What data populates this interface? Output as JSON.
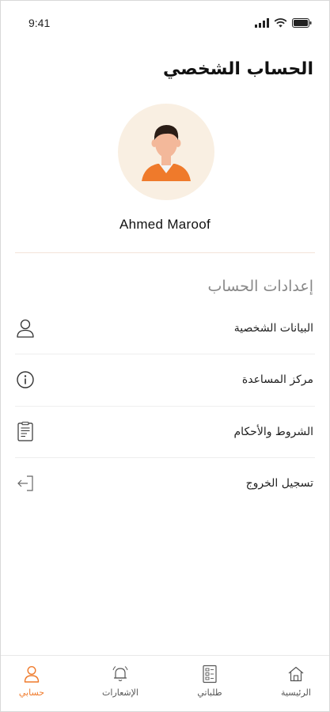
{
  "status_bar": {
    "time": "9:41"
  },
  "header": {
    "title": "الحساب الشخصي"
  },
  "profile": {
    "name": "Ahmed Maroof"
  },
  "settings": {
    "section_title": "إعدادات الحساب",
    "items": [
      {
        "label": "البيانات الشخصية",
        "icon": "user-icon"
      },
      {
        "label": "مركز المساعدة",
        "icon": "info-icon"
      },
      {
        "label": "الشروط والأحكام",
        "icon": "document-icon"
      },
      {
        "label": "تسجيل الخروج",
        "icon": "logout-icon"
      }
    ]
  },
  "tabbar": {
    "tabs": [
      {
        "label": "الرئيسية",
        "icon": "home-icon",
        "active": false
      },
      {
        "label": "طلباتي",
        "icon": "orders-icon",
        "active": false
      },
      {
        "label": "الإشعارات",
        "icon": "bell-icon",
        "active": false
      },
      {
        "label": "حسابي",
        "icon": "user-icon",
        "active": true
      }
    ]
  },
  "colors": {
    "accent": "#ef7a2b",
    "avatar_bg": "#f9efe2",
    "text": "#222222",
    "muted": "#888888"
  }
}
